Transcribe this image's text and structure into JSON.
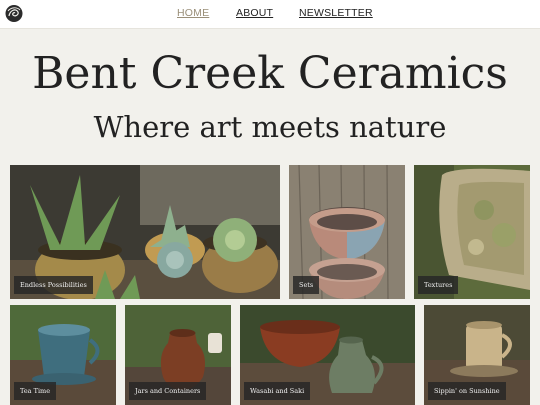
{
  "nav": {
    "logo_icon": "swirl-logo-icon",
    "items": [
      {
        "label": "HOME",
        "active": true
      },
      {
        "label": "ABOUT",
        "active": false
      },
      {
        "label": "NEWSLETTER",
        "active": false
      }
    ]
  },
  "hero": {
    "title": "Bent Creek Ceramics",
    "tagline": "Where art meets nature"
  },
  "gallery": {
    "row1": [
      {
        "caption": "Endless Possibilities"
      },
      {
        "caption": "Sets"
      },
      {
        "caption": "Textures"
      }
    ],
    "row2": [
      {
        "caption": "Tea Time"
      },
      {
        "caption": "Jars and Containers"
      },
      {
        "caption": "Wasabi and Saki"
      },
      {
        "caption": "Sippin' on Sunshine"
      }
    ]
  },
  "colors": {
    "page_background": "#f2f1ec",
    "nav_active": "#9a8f79",
    "caption_background": "#262626"
  }
}
